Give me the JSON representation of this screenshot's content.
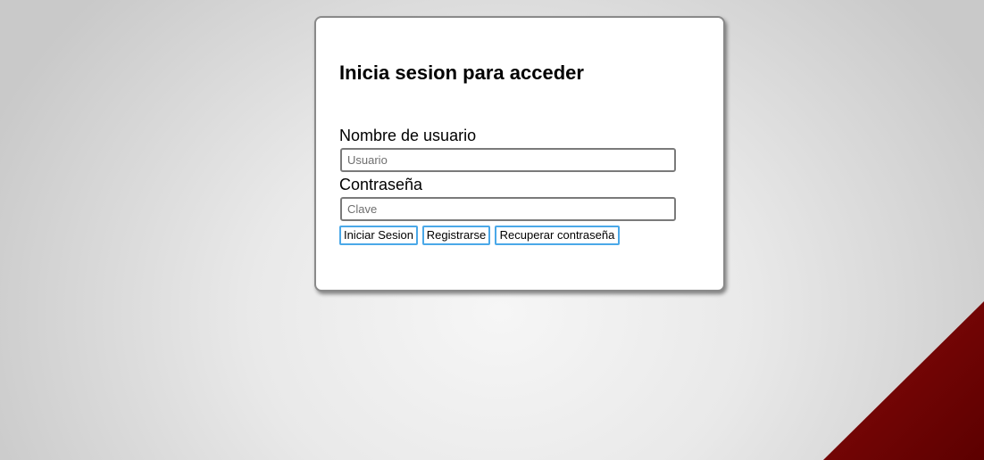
{
  "login": {
    "title": "Inicia sesion para acceder",
    "username_label": "Nombre de usuario",
    "username_placeholder": "Usuario",
    "username_value": "",
    "password_label": "Contraseña",
    "password_placeholder": "Clave",
    "password_value": "",
    "buttons": {
      "login": "Iniciar Sesion",
      "register": "Registrarse",
      "recover": "Recuperar contraseña"
    }
  },
  "colors": {
    "button_border": "#4aa8e8",
    "corner_accent": "#6b0000",
    "background": "#e6e6e6"
  }
}
